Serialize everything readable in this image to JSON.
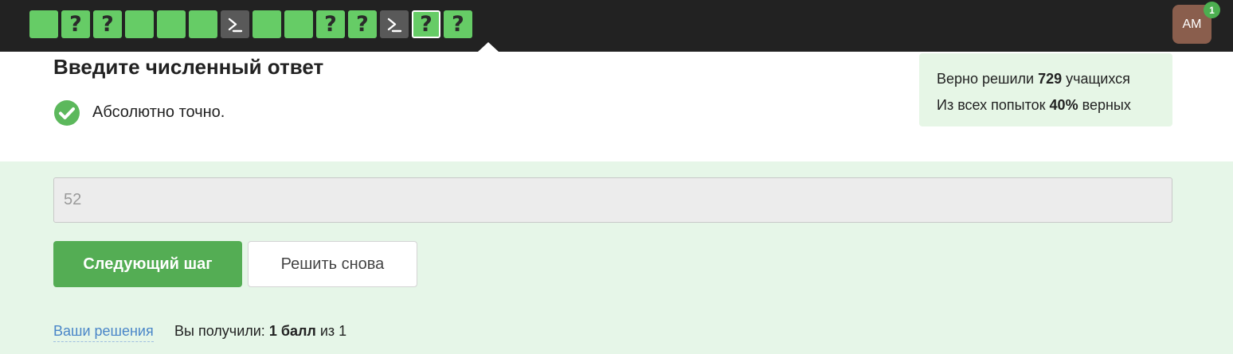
{
  "topbar": {
    "steps": [
      {
        "type": "blank",
        "color": "green"
      },
      {
        "type": "question",
        "color": "green",
        "glyph": "?"
      },
      {
        "type": "question",
        "color": "green",
        "glyph": "?"
      },
      {
        "type": "blank",
        "color": "green"
      },
      {
        "type": "blank",
        "color": "green"
      },
      {
        "type": "blank",
        "color": "green"
      },
      {
        "type": "terminal",
        "color": "dark",
        "icon": "terminal-icon"
      },
      {
        "type": "blank",
        "color": "green"
      },
      {
        "type": "blank",
        "color": "green"
      },
      {
        "type": "question",
        "color": "green",
        "glyph": "?"
      },
      {
        "type": "question",
        "color": "green",
        "glyph": "?"
      },
      {
        "type": "terminal",
        "color": "dark",
        "icon": "terminal-icon"
      },
      {
        "type": "question",
        "color": "green",
        "glyph": "?",
        "active": true
      },
      {
        "type": "question",
        "color": "green",
        "glyph": "?"
      }
    ],
    "avatar": {
      "initials": "AM",
      "badge": "1"
    }
  },
  "task": {
    "title": "Введите численный ответ",
    "status": "Абсолютно точно.",
    "status_icon": "check-circle-icon"
  },
  "stats": {
    "line1_prefix": "Верно решили ",
    "line1_value": "729",
    "line1_suffix": " учащихся",
    "line2_prefix": "Из всех попыток ",
    "line2_value": "40%",
    "line2_suffix": " верных"
  },
  "answer": {
    "value": "52"
  },
  "buttons": {
    "next_label": "Следующий шаг",
    "retry_label": "Решить снова"
  },
  "footer": {
    "solutions_link": "Ваши решения",
    "score_prefix": "Вы получили: ",
    "score_value": "1 балл",
    "score_suffix": " из 1"
  },
  "colors": {
    "topbar_bg": "#222222",
    "step_green": "#66cc66",
    "step_dark": "#595959",
    "button_green": "#54ad54",
    "answer_area_bg": "#e6f6e8",
    "stats_bg": "#e6f6e6",
    "link_blue": "#4a86c8",
    "avatar_bg": "#8a5e4d"
  }
}
